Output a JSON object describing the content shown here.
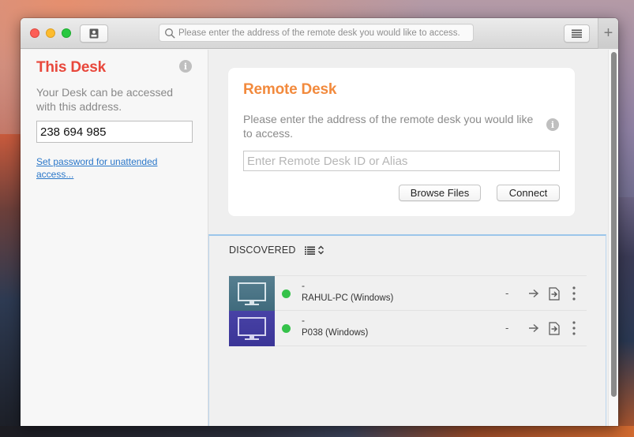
{
  "window": {
    "search_placeholder": "Please enter the address of the remote desk you would like to access.",
    "new_tab_label": "+"
  },
  "this_desk": {
    "title": "This Desk",
    "description": "Your Desk can be accessed with this address.",
    "address": "238 694 985",
    "password_link": "Set password for unattended access...",
    "title_color": "#e8473b"
  },
  "remote_desk": {
    "title": "Remote Desk",
    "description": "Please enter the address of the remote desk you would like to access.",
    "input_placeholder": "Enter Remote Desk ID or Alias",
    "input_value": "",
    "browse_files_label": "Browse Files",
    "connect_label": "Connect",
    "title_color": "#f28a3d"
  },
  "discovered": {
    "label": "DISCOVERED",
    "devices": [
      {
        "alias": "-",
        "name": "RAHUL-PC (Windows)",
        "status": "online",
        "extra": "-",
        "thumb_color": "#4f7888"
      },
      {
        "alias": "-",
        "name": "P038 (Windows)",
        "status": "online",
        "extra": "-",
        "thumb_color": "#433d9f"
      }
    ]
  },
  "icons": {
    "info": "i"
  }
}
